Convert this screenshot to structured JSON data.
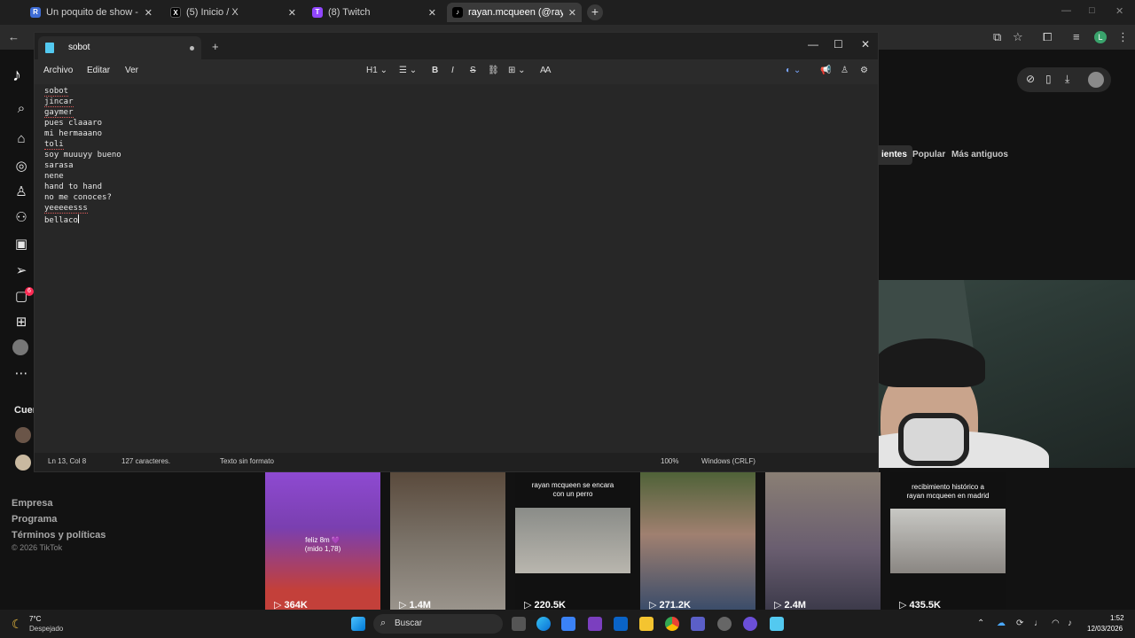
{
  "browser": {
    "tabs": [
      {
        "label": "Un poquito de show - Restrean",
        "favicon": "R",
        "color": "#3f6dd6"
      },
      {
        "label": "(5) Inicio / X",
        "favicon": "X",
        "color": "#000000"
      },
      {
        "label": "(8) Twitch",
        "favicon": "T",
        "color": "#9146ff"
      },
      {
        "label": "rayan.mcqueen (@rayan.mcque",
        "favicon": "t",
        "color": "#000000"
      }
    ],
    "new_tab": "+",
    "profile_initial": "L"
  },
  "tiktok": {
    "following_title": "Cuen",
    "footer": {
      "company": "Empresa",
      "program": "Programa",
      "terms": "Términos y políticas",
      "copyright": "© 2026 TikTok"
    },
    "sort_options": [
      "ientes",
      "Popular",
      "Más antiguos"
    ],
    "inbox_count": "6",
    "videos": [
      {
        "views": "364K",
        "caption": "feliz 8m 💜\n(mido 1,78)",
        "color": "#7a3fb0"
      },
      {
        "views": "1.4M",
        "caption": "",
        "color": "#6f6a60"
      },
      {
        "views": "220.5K",
        "caption": "rayan mcqueen se encara\ncon un perro",
        "color": "#111111"
      },
      {
        "views": "271.2K",
        "caption": "",
        "color": "#5b6a3a"
      },
      {
        "views": "2.4M",
        "caption": "",
        "color": "#8a7f74"
      },
      {
        "views": "435.5K",
        "caption": "recibimiento histórico a\nrayan mcqueen en madrid",
        "color": "#111111"
      }
    ]
  },
  "notepad": {
    "tab_title": "sobot",
    "new_tab": "+",
    "menu": [
      "Archivo",
      "Editar",
      "Ver"
    ],
    "heading_selector": "H1",
    "lines": [
      {
        "text": "sobot",
        "spell": true
      },
      {
        "text": "jincar",
        "spell": true
      },
      {
        "text": "gaymer",
        "spell": true
      },
      {
        "text": "pues claaaro",
        "spell": false
      },
      {
        "text": "mi hermaaano",
        "spell": false
      },
      {
        "text": "toli",
        "spell": true
      },
      {
        "text": "soy muuuyy bueno",
        "spell": false
      },
      {
        "text": "sarasa",
        "spell": false
      },
      {
        "text": "nene",
        "spell": false
      },
      {
        "text": "hand to hand",
        "spell": false
      },
      {
        "text": "no me conoces?",
        "spell": false
      },
      {
        "text": "yeeeeesss",
        "spell": true
      },
      {
        "text": "bellaco",
        "spell": false
      }
    ],
    "status": {
      "position": "Ln 13, Col 8",
      "chars": "127 caracteres.",
      "format": "Texto sin formato",
      "zoom": "100%",
      "eol": "Windows (CRLF)"
    }
  },
  "taskbar": {
    "weather_temp": "7°C",
    "weather_desc": "Despejado",
    "search_placeholder": "Buscar",
    "time": "1:52",
    "date": "12/03/2026"
  }
}
